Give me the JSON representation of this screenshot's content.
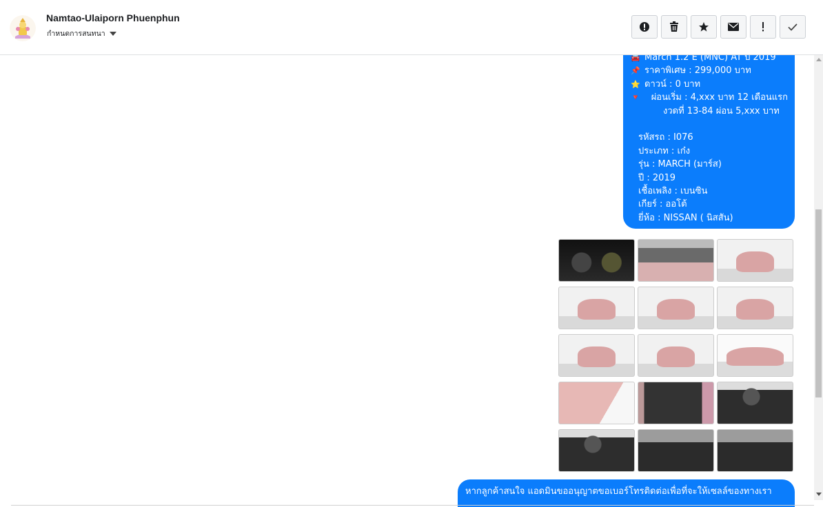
{
  "header": {
    "contact_name": "Namtao-Ulaiporn Phuenphun",
    "subtitle": "กำหนดการสนทนา"
  },
  "toolbar": {
    "buttons": [
      {
        "icon": "alert-circle-icon"
      },
      {
        "icon": "trash-icon"
      },
      {
        "icon": "star-icon"
      },
      {
        "icon": "envelope-icon"
      },
      {
        "icon": "exclamation-icon"
      },
      {
        "icon": "check-icon"
      }
    ]
  },
  "message": {
    "lines": [
      {
        "emoji": "🚘",
        "text": "March 1.2 E (MNC) AT ปี 2019"
      },
      {
        "emoji": "📌",
        "text": "ราคาพิเศษ : 299,000 บาท"
      },
      {
        "emoji": "⭐",
        "text": "ดาวน์ : 0 บาท"
      },
      {
        "emoji": "🔻",
        "text": "ผ่อนเริ่ม : 4,xxx บาท 12 เดือนแรก"
      },
      {
        "text": "งวดที่ 13-84 ผ่อน 5,xxx บาท"
      },
      {
        "text": "รหัสรถ : I076"
      },
      {
        "text": "ประเภท : เก๋ง"
      },
      {
        "text": "รุ่น : MARCH (มาร์ส)"
      },
      {
        "text": "ปี : 2019"
      },
      {
        "text": "เชื้อเพลิง : เบนซิน"
      },
      {
        "text": "เกียร์ : ออโต้"
      },
      {
        "text": "ยี่ห้อ : NISSAN ( นิสสัน)"
      }
    ]
  },
  "photos": [
    "dashboard",
    "engine-bay",
    "front-three-quarter",
    "front",
    "front-angle",
    "rear-three-quarter",
    "rear",
    "rear-angle",
    "side",
    "front-close",
    "door-interior",
    "interior-dashboard",
    "driver-seat",
    "rear-seats",
    "center-console"
  ],
  "last_message": {
    "text": "หากลูกค้าสนใจ แอดมินขออนุญาตขอเบอร์โทรติดต่อเพื่อที่จะให้เซลล์ของทางเรา"
  },
  "colors": {
    "bubble": "#0b7dfc",
    "bubble_text": "#ffffff",
    "toolbar_button_bg": "#f5f6f7"
  }
}
